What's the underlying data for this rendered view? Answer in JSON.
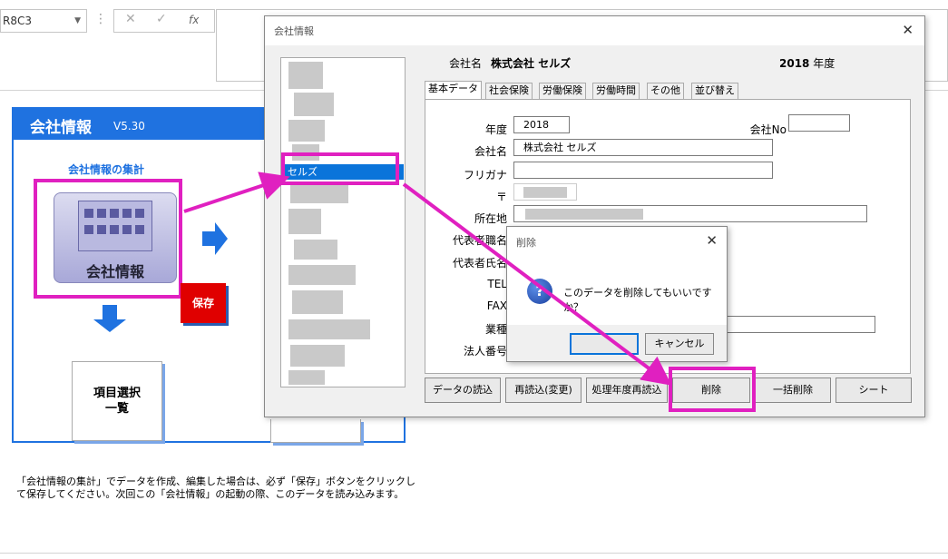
{
  "excel": {
    "name_box": "R8C3",
    "cancel_icon": "✕",
    "enter_icon": "✓",
    "fx_icon": "fx"
  },
  "panel": {
    "title": "会社情報",
    "version": "V5.30",
    "aggregate_label": "会社情報の集計",
    "building_label": "会社情報",
    "save_button": "保存",
    "item_select_line1": "項目選択",
    "item_select_line2": "一覧",
    "note": "「会社情報の集計」でデータを作成、編集した場合は、必ず「保存」ボタンをクリックして保存してください。次回この「会社情報」の起動の際、このデータを読み込みます。"
  },
  "dialog": {
    "title": "会社情報",
    "company_label": "会社名",
    "company_value": "株式会社 セルズ",
    "year_value": "2018",
    "year_unit": "年度",
    "selected_item": "セルズ",
    "tabs": [
      "基本データ",
      "社会保険",
      "労働保険",
      "労働時間",
      "その他",
      "並び替え"
    ],
    "fields": {
      "year_label": "年度",
      "year_value": "2018",
      "company_no_label": "会社No",
      "company_no_value": "",
      "company_name_label": "会社名",
      "company_name_value": "株式会社 セルズ",
      "furigana_label": "フリガナ",
      "furigana_value": "",
      "postal_label": "〒",
      "address_label": "所在地",
      "rep_title_label": "代表者職名",
      "rep_name_label": "代表者氏名",
      "tel_label": "TEL",
      "fax_label": "FAX",
      "industry_label": "業種",
      "corp_no_label": "法人番号"
    },
    "buttons": [
      "データの読込",
      "再読込(変更)",
      "処理年度再読込",
      "削除",
      "一括削除",
      "シート"
    ]
  },
  "confirm": {
    "title": "削除",
    "message": "このデータを削除してもいいですか？",
    "ok": "",
    "cancel": "キャンセル",
    "icon": "?"
  },
  "colors": {
    "accent": "#1f72e0",
    "highlight": "#e020c0",
    "save": "#e00000",
    "selection": "#0a74da"
  }
}
